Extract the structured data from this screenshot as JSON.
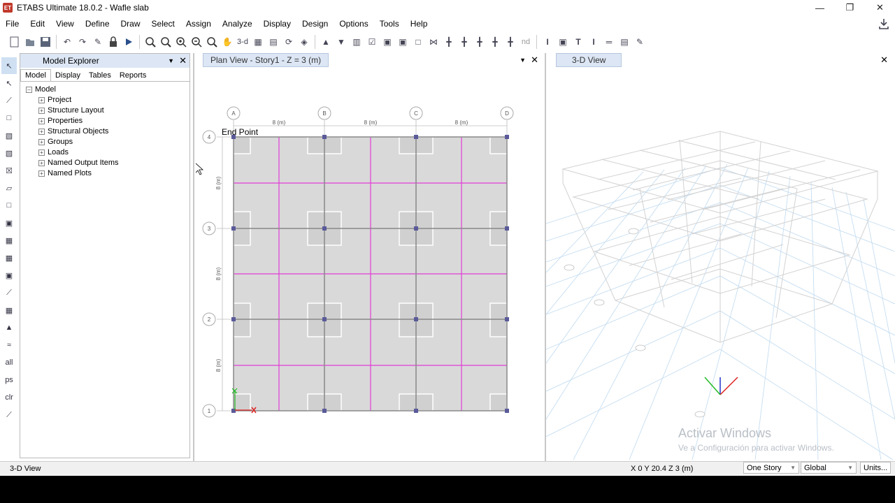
{
  "window": {
    "logo": "ET",
    "title": "ETABS Ultimate 18.0.2 - Wafle slab",
    "minimize_icon": "minimize-icon",
    "restore_icon": "restore-icon",
    "close_icon": "close-icon"
  },
  "menu": [
    "File",
    "Edit",
    "View",
    "Define",
    "Draw",
    "Select",
    "Assign",
    "Analyze",
    "Display",
    "Design",
    "Options",
    "Tools",
    "Help"
  ],
  "toolbar": {
    "text_3d": "3-d",
    "text_nd": "nd"
  },
  "explorer": {
    "title": "Model Explorer",
    "tabs": [
      "Model",
      "Display",
      "Tables",
      "Reports"
    ],
    "root": "Model",
    "items": [
      "Project",
      "Structure Layout",
      "Properties",
      "Structural Objects",
      "Groups",
      "Loads",
      "Named Output Items",
      "Named Plots"
    ]
  },
  "plan_view": {
    "title": "Plan View - Story1 - Z = 3 (m)",
    "tooltip": "End Point",
    "grid_cols": [
      "A",
      "B",
      "C",
      "D"
    ],
    "grid_rows": [
      "4",
      "3",
      "2",
      "1"
    ],
    "spacing_label": "8 (m)"
  },
  "view3d": {
    "title": "3-D View"
  },
  "watermark": {
    "line1": "Activar Windows",
    "line2": "Ve a Configuración para activar Windows."
  },
  "status": {
    "left": "3-D View",
    "coords": "X 0  Y 20.4  Z 3 (m)",
    "story": "One Story",
    "coord_system": "Global",
    "units": "Units..."
  }
}
